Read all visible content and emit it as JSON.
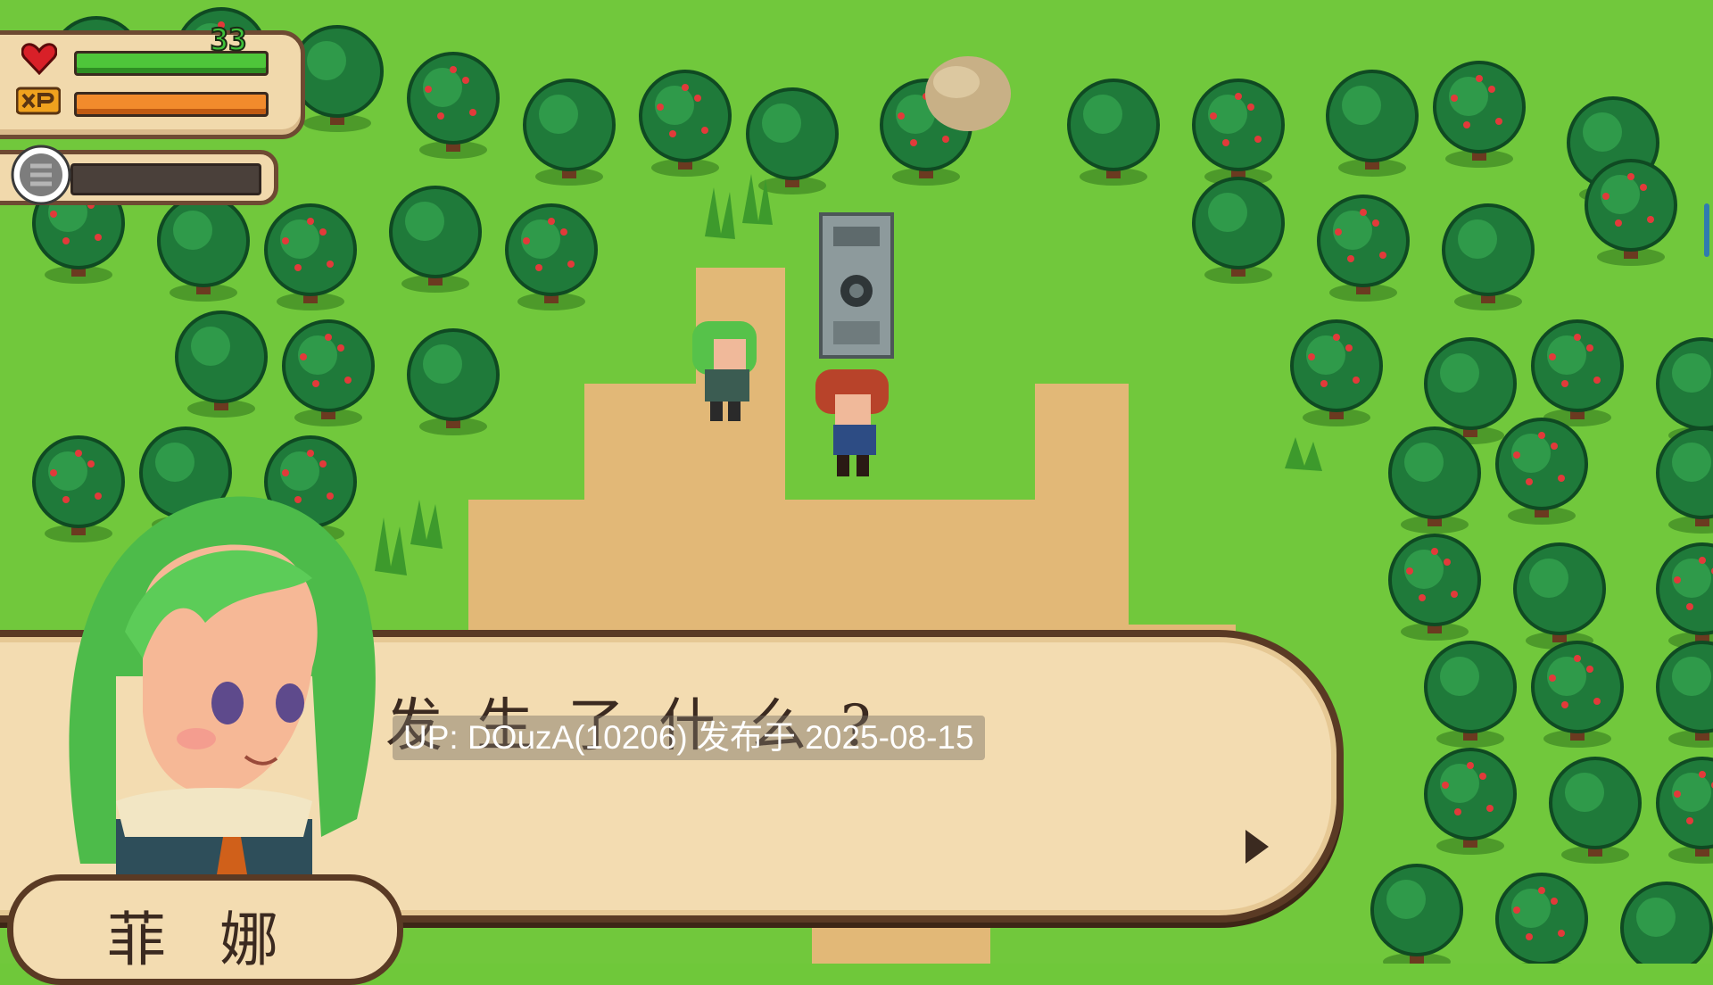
{
  "hud": {
    "level": "33",
    "hp_fraction": 1.0,
    "xp_fraction": 1.0,
    "shield_fraction": 0.0,
    "colors": {
      "hp": "#4ec63a",
      "xp": "#f28b2c",
      "panel": "#f1d9ac",
      "border": "#6e4a32"
    },
    "icons": [
      "heart-icon",
      "xp-icon",
      "shield-icon"
    ]
  },
  "dialog": {
    "text": "发生了什么?",
    "speaker": "菲娜",
    "continue_icon": "triangle-right-icon"
  },
  "watermark": {
    "text": "UP: DOuzA(10206) 发布于 2025-08-15"
  },
  "scene": {
    "icons": [
      "tree-icon",
      "apple-tree-icon",
      "boulder-icon",
      "stone-monument-icon",
      "grass-tuft-icon",
      "green-haired-girl-sprite",
      "red-haired-hero-sprite",
      "speaker-portrait"
    ]
  }
}
